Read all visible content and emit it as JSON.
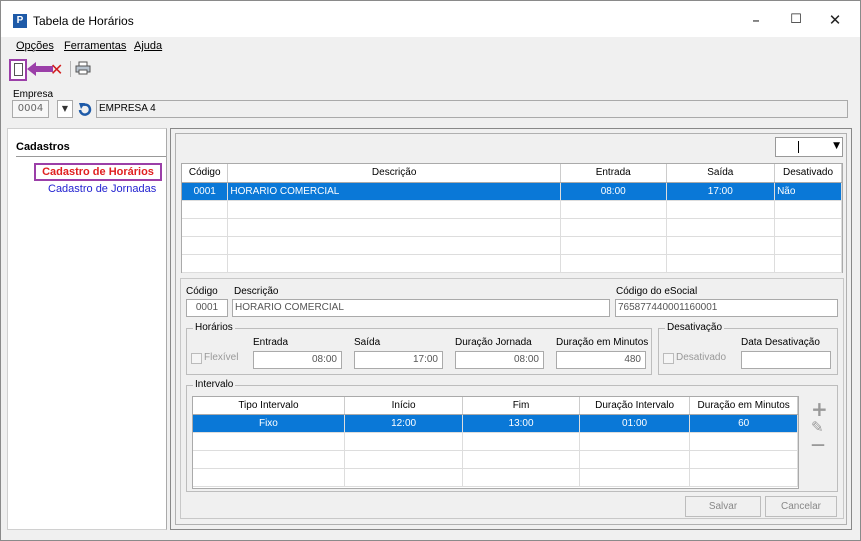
{
  "window": {
    "title": "Tabela de Horários",
    "app_icon": "app-p-icon",
    "minimize": "–",
    "maximize": "☐",
    "close": "✕"
  },
  "menu": [
    {
      "label": "Opções"
    },
    {
      "label": "Ferramentas"
    },
    {
      "label": "Ajuda"
    }
  ],
  "toolbar": {
    "new_icon": "new-document-icon",
    "delete_icon": "delete-x-icon",
    "delete_glyph": "✕",
    "print_icon": "printer-icon"
  },
  "empresa": {
    "label": "Empresa",
    "code": "0004",
    "name": "EMPRESA 4",
    "dropdown": "▼"
  },
  "sidebar": {
    "title": "Cadastros",
    "items": [
      {
        "label": "Cadastro de Horários"
      },
      {
        "label": "Cadastro de Jornadas"
      }
    ]
  },
  "top_combo": {
    "dropdown": "▼"
  },
  "grid": {
    "columns": [
      "Código",
      "Descrição",
      "Entrada",
      "Saída",
      "Desativado"
    ],
    "rows": [
      {
        "codigo": "0001",
        "descricao": "HORARIO COMERCIAL",
        "entrada": "08:00",
        "saida": "17:00",
        "desativado": "Não"
      }
    ]
  },
  "form": {
    "codigo_label": "Código",
    "codigo": "0001",
    "descricao_label": "Descrição",
    "descricao": "HORARIO COMERCIAL",
    "esocial_label": "Código do eSocial",
    "esocial": "765877440001160001",
    "horarios": {
      "title": "Horários",
      "flexivel": "Flexível",
      "entrada_label": "Entrada",
      "entrada": "08:00",
      "saida_label": "Saída",
      "saida": "17:00",
      "duracao_jornada_label": "Duração Jornada",
      "duracao_jornada": "08:00",
      "duracao_minutos_label": "Duração em Minutos",
      "duracao_minutos": "480"
    },
    "desativacao": {
      "title": "Desativação",
      "desativado": "Desativado",
      "data_label": "Data Desativação",
      "data": ""
    },
    "intervalo": {
      "title": "Intervalo",
      "columns": [
        "Tipo Intervalo",
        "Início",
        "Fim",
        "Duração Intervalo",
        "Duração em Minutos"
      ],
      "rows": [
        {
          "tipo": "Fixo",
          "inicio": "12:00",
          "fim": "13:00",
          "duracao": "01:00",
          "minutos": "60"
        }
      ],
      "add_glyph": "+",
      "edit_glyph": "✎",
      "remove_glyph": "—"
    },
    "salvar": "Salvar",
    "cancelar": "Cancelar"
  }
}
